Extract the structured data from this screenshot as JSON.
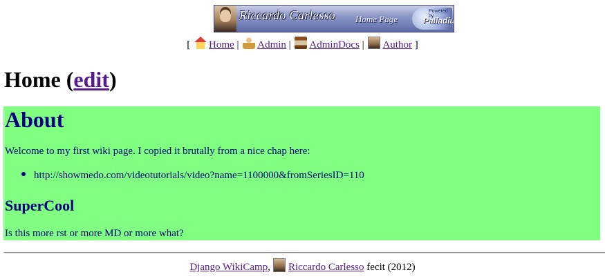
{
  "banner": {
    "name": "Riccardo Carlesso",
    "subtitle": "Home Page",
    "powered_line1": "Powered by",
    "powered_line2": "Palladius"
  },
  "nav": {
    "open": "[",
    "close": "]",
    "sep": "|",
    "items": [
      {
        "label": "Home",
        "icon": "home-icon"
      },
      {
        "label": "Admin",
        "icon": "admin-icon"
      },
      {
        "label": "AdminDocs",
        "icon": "docs-icon"
      },
      {
        "label": "Author",
        "icon": "author-icon"
      }
    ]
  },
  "page": {
    "title": "Home",
    "paren_open": "(",
    "edit_label": "edit",
    "paren_close": ")"
  },
  "content": {
    "bg_color": "#80ff80",
    "text_color": "#000080",
    "heading": "About",
    "intro": "Welcome to my first wiki page. I copied it brutally from a nice chap here:",
    "bullets": [
      "http://showmedo.com/videotutorials/video?name=1100000&fromSeriesID=110"
    ],
    "subheading": "SuperCool",
    "question": "Is this more rst or more MD or more what?"
  },
  "footer": {
    "app_link": "Django WikiCamp",
    "comma": ",",
    "author_link": "Riccardo Carlesso",
    "suffix": "fecit (2012)"
  }
}
